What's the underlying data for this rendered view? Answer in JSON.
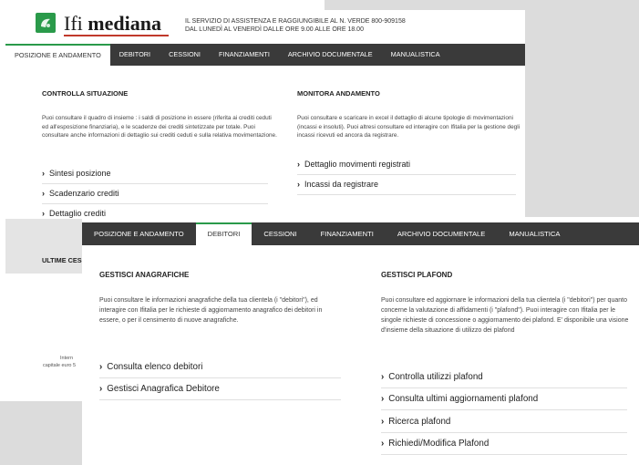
{
  "header": {
    "logo_ifi": "Ifi",
    "logo_mediana": "mediana",
    "service_line1": "IL SERVIZIO DI ASSISTENZA E RAGGIUNGIBILE AL N. VERDE 800-909158",
    "service_line2": "DAL LUNEDÌ AL VENERDÌ DALLE ORE 9.00 ALLE ORE 18.00"
  },
  "nav_back": [
    "POSIZIONE E ANDAMENTO",
    "DEBITORI",
    "CESSIONI",
    "FINANZIAMENTI",
    "ARCHIVIO DOCUMENTALE",
    "MANUALISTICA"
  ],
  "nav_front": [
    "POSIZIONE E ANDAMENTO",
    "DEBITORI",
    "CESSIONI",
    "FINANZIAMENTI",
    "ARCHIVIO DOCUMENTALE",
    "MANUALISTICA"
  ],
  "back": {
    "left": {
      "title": "CONTROLLA SITUAZIONE",
      "desc": "Puoi consultare il quadro di insieme : i saldi di posizione in essere (riferita ai crediti ceduti ed all'esposizione finanziaria), e le scadenze dei crediti sintetizzate per totale. Puoi consultare anche informazioni di dettaglio sui crediti ceduti e sulla relativa movimentazione.",
      "links": [
        "Sintesi posizione",
        "Scadenzario crediti",
        "Dettaglio crediti"
      ]
    },
    "right": {
      "title": "MONITORA ANDAMENTO",
      "desc": "Puoi consultare e scaricare in excel il dettaglio di alcune tipologie di movimentazioni (incassi e insoluti). Puoi altresi consultare ed interagire con Ifitalia per la gestione degli incassi ricevuti ed ancora da registrare.",
      "links": [
        "Dettaglio movimenti registrati",
        "Incassi da registrare"
      ]
    },
    "ultime_title": "ULTIME CES",
    "footer_line1": "Intern",
    "footer_line2": "capitale euro 5"
  },
  "front": {
    "left": {
      "title": "GESTISCI ANAGRAFICHE",
      "desc": "Puoi consultare le informazioni anagrafiche della tua clientela (i \"debitori\"), ed interagire con Ifitalia per le richieste di aggiornamento anagrafico dei debitori in essere, o per il censimento di nuove anagrafiche.",
      "links": [
        "Consulta elenco debitori",
        "Gestisci Anagrafica Debitore"
      ]
    },
    "right": {
      "title": "GESTISCI PLAFOND",
      "desc": "Puoi consultare ed aggiornare le informazioni della tua clientela (i \"debitori\") per quanto concerne la valutazione di affidamenti (i \"plafond\"). Puoi interagire con Ifitalia per le singole richieste di concessione o aggiornamento dei plafond. E' disponibile una visione d'insieme della situazione di utilizzo dei plafond",
      "links": [
        "Controlla utilizzi plafond",
        "Consulta ultimi aggiornamenti plafond",
        "Ricerca plafond",
        "Richiedi/Modifica Plafond"
      ]
    }
  },
  "icons": {
    "chevron": "›"
  },
  "colors": {
    "accent": "#2a9a4a",
    "nav_bg": "#3a3a3a",
    "logo_underline": "#c0392b"
  }
}
